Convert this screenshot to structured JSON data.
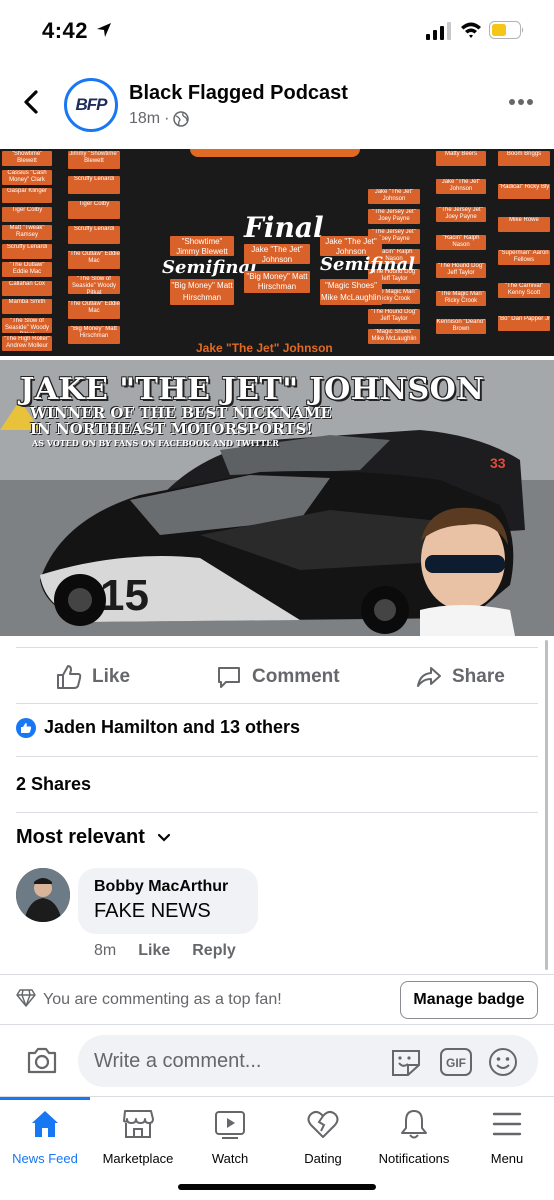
{
  "status_bar": {
    "time": "4:42"
  },
  "post": {
    "page_name": "Black Flagged Podcast",
    "page_avatar_text": "BFP",
    "time_ago": "18m",
    "separator": "·"
  },
  "bracket_image": {
    "final_label": "Final",
    "semifinal_left": "Semifinal",
    "semifinal_right": "Semifinal",
    "winner": "Jake \"The Jet\" Johnson",
    "final_pair": [
      "Jake \"The Jet\" Johnson",
      "\"Big Money\" Matt Hirschman"
    ],
    "semi_left": [
      "\"Showtime\" Jimmy Blewett",
      "\"Big Money\" Matt Hirschman"
    ],
    "semi_right": [
      "Jake \"The Jet\" Johnson",
      "\"Magic Shoes\" Mike McLaughlin"
    ],
    "left_round1": [
      "\"Showtime\" Blewett",
      "Cassius \"Cash Money\" Clark",
      "Gaspar Klinger",
      "Tiger Colby",
      "Matt \"Tweak\" Ramsey",
      "Scruffy Lenardi",
      "\"The Outlaw\" Eddie Mac",
      "Callahan Cox",
      "Mamba Smith",
      "\"The Slow of Seaside\" Woody Pitkat",
      "\"The High Roller\" Andrew Molleur"
    ],
    "right_round1": [
      "Matty Beers",
      "Boom Briggs",
      "Jake \"The Jet\" Johnson",
      "\"Radical\" Ricky Bly",
      "\"The Jersey Jet\" Joey Payne",
      "Mike Rowe",
      "\"Racin\" Ralph Nason",
      "\"Superman\" Aaron Fellows",
      "\"The Hound Dog\" Jeff Taylor",
      "\"The Carnival\" Kenny Scott",
      "\"The Magic Man\" Ricky Crook",
      "\"Bo\" Dan Papper Jr",
      "Kennison \"Deano\" Brown"
    ],
    "left_round2": [
      "Jimmy \"Showtime\" Blewett",
      "Scruffy Lenardi",
      "Tiger Colby",
      "Scruffy Lenardi",
      "\"The Outlaw\" Eddie Mac",
      "\"The Slow of Seaside\" Woody Pitkat",
      "\"The Outlaw\" Eddie Mac",
      "\"Big Money\" Matt Hirschman"
    ],
    "right_round2": [
      "Jake \"The Jet\" Johnson",
      "\"The Jersey Jet\" Joey Payne",
      "\"The Jersey Jet\" Joey Payne",
      "\"Racin\" Ralph Nason",
      "\"The Hound Dog\" Jeff Taylor",
      "\"The Magic Man\" Ricky Crook",
      "\"The Hound Dog\" Jeff Taylor",
      "\"Magic Shoes\" Mike McLaughlin"
    ]
  },
  "hero_image": {
    "title": "JAKE \"THE JET\" JOHNSON",
    "subtitle_line1": "WINNER OF THE BEST NICKNAME",
    "subtitle_line2": "IN NORTHEAST MOTORSPORTS!",
    "subtitle_line3": "AS VOTED ON BY FANS ON FACEBOOK AND TWITTER",
    "car_number_front": "15",
    "car_number_back": "33"
  },
  "actions": {
    "like": "Like",
    "comment": "Comment",
    "share": "Share"
  },
  "reactions": {
    "text": "Jaden Hamilton and 13 others"
  },
  "shares": {
    "text": "2 Shares"
  },
  "sort": {
    "label": "Most relevant"
  },
  "comment": {
    "author": "Bobby MacArthur",
    "text": "FAKE NEWS",
    "time": "8m",
    "like": "Like",
    "reply": "Reply"
  },
  "top_fan": {
    "text": "You are commenting as a top fan!",
    "button": "Manage badge"
  },
  "compose": {
    "placeholder": "Write a comment..."
  },
  "tabs": [
    {
      "label": "News Feed",
      "icon": "home-icon",
      "active": true
    },
    {
      "label": "Marketplace",
      "icon": "marketplace-icon"
    },
    {
      "label": "Watch",
      "icon": "watch-icon"
    },
    {
      "label": "Dating",
      "icon": "dating-icon"
    },
    {
      "label": "Notifications",
      "icon": "bell-icon"
    },
    {
      "label": "Menu",
      "icon": "menu-icon"
    }
  ],
  "colors": {
    "accent": "#1877f2",
    "secondary_text": "#65676b",
    "bracket_orange": "#e06a23",
    "battery_yellow": "#f5c518"
  }
}
